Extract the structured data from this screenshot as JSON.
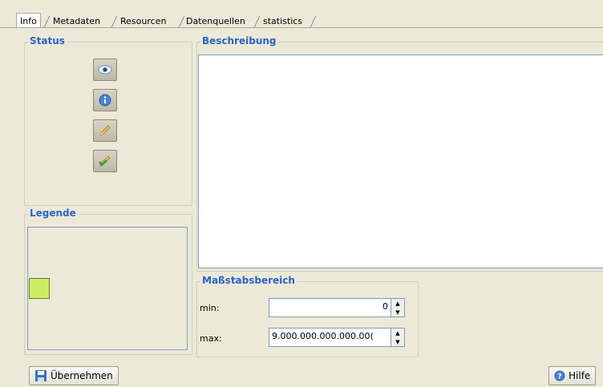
{
  "tabs": [
    "Info",
    "Metadaten",
    "Resourcen",
    "Datenquellen",
    "statistics"
  ],
  "status": {
    "title": "Status",
    "buttons": [
      "eye-icon",
      "info-icon",
      "pencil-icon",
      "pencil-check-icon"
    ]
  },
  "legende": {
    "title": "Legende",
    "swatch_color": "#ccee66"
  },
  "beschreibung": {
    "title": "Beschreibung",
    "text": ""
  },
  "massstab": {
    "title": "Maßstabsbereich",
    "min_label": "min:",
    "min_value": "0",
    "max_label": "max:",
    "max_value": "9.000.000.000.000.00("
  },
  "footer": {
    "apply_label": "Übernehmen",
    "help_label": "Hilfe"
  },
  "colors": {
    "accent": "#2b63c9",
    "background": "#ece9d8"
  }
}
